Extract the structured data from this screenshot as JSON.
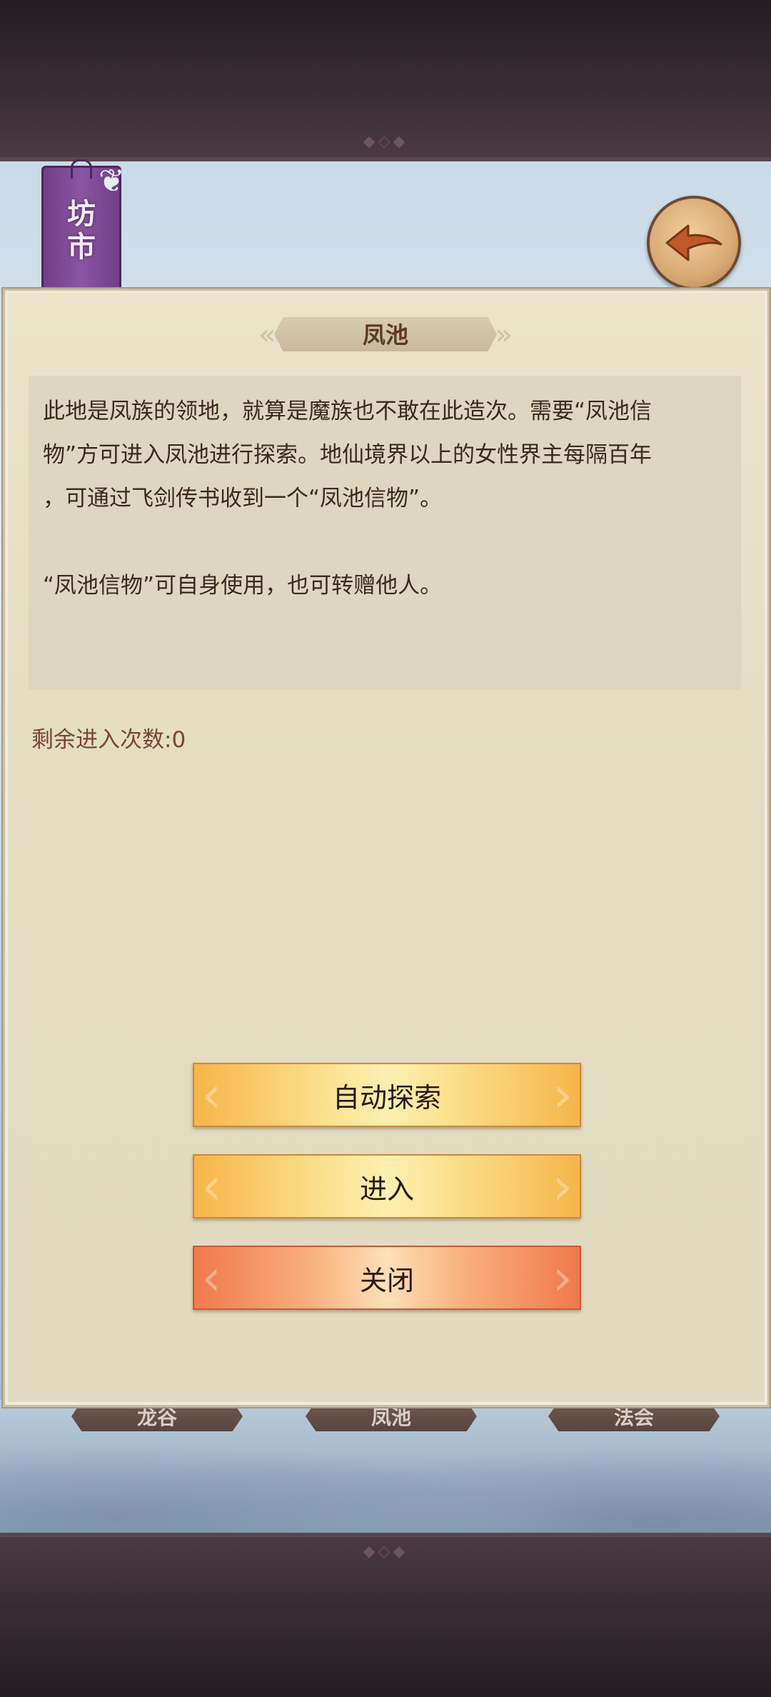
{
  "header": {
    "shop_banner": [
      "坊",
      "市"
    ]
  },
  "panel": {
    "title": "凤池",
    "description": "此地是凤族的领地，就算是魔族也不敢在此造次。需要“凤池信\n物”方可进入凤池进行探索。地仙境界以上的女性界主每隔百年\n，可通过飞剑传书收到一个“凤池信物”。\n\n“凤池信物”可自身使用，也可转赠他人。",
    "remaining_label": "剩余进入次数:",
    "remaining_count": "0"
  },
  "buttons": {
    "auto_explore": "自动探索",
    "enter": "进入",
    "close": "关闭"
  },
  "bottom_tabs": [
    "龙谷",
    "凤池",
    "法会"
  ],
  "colors": {
    "panel_bg": "#e6dfc5",
    "title_text": "#5c3a24",
    "remaining_text": "#7a4436",
    "button_gold": "#f6b54a",
    "button_orange": "#f0794a",
    "shop_banner": "#8b55a3"
  },
  "icons": {
    "back": "back-arrow-icon",
    "shop": "shop-banner-icon"
  }
}
